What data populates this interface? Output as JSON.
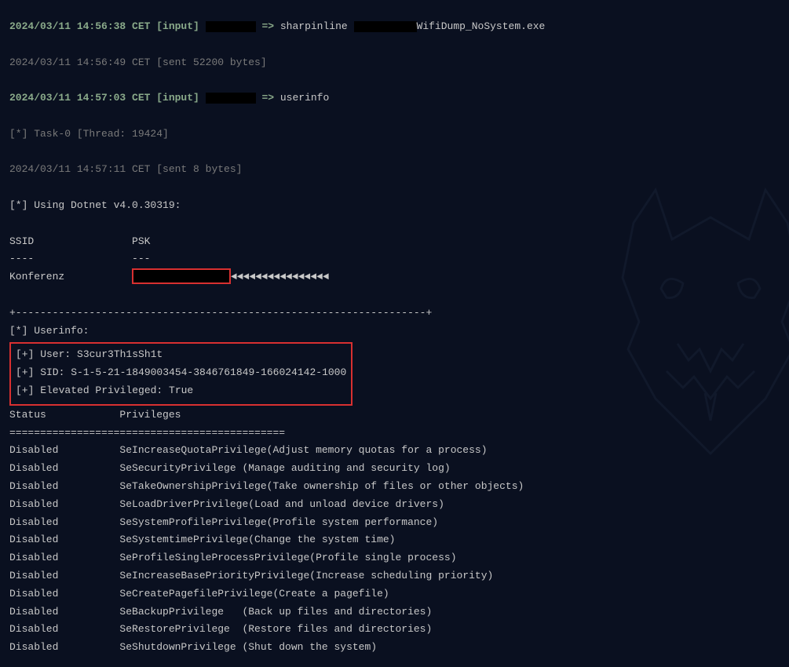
{
  "lines": {
    "l1_ts": "2024/03/11 14:56:38 CET [input]",
    "l1_arrow": " => ",
    "l1_cmd": "sharpinline",
    "l1_exe": "WifiDump_NoSystem.exe",
    "l2": "2024/03/11 14:56:49 CET [sent 52200 bytes]",
    "l3_ts": "2024/03/11 14:57:03 CET [input]",
    "l3_arrow": " => ",
    "l3_cmd": "userinfo",
    "l4": "[*] Task-0 [Thread: 19424]",
    "l5": "2024/03/11 14:57:11 CET [sent 8 bytes]",
    "l6": "[*] Using Dotnet v4.0.30319:",
    "hdr_ssid": "SSID",
    "hdr_psk": "PSK",
    "sep_ssid": "----",
    "sep_psk": "---",
    "ssid_name": "Konferenz",
    "triangles": "◄◄◄◄◄◄◄◄◄◄◄◄◄◄◄◄",
    "divider": "+-------------------------------------------------------------------+",
    "userinfo_hdr": "[*] Userinfo:",
    "user_line": "[+] User: S3cur3Th1sSh1t",
    "sid_line": "[+] SID: S-1-5-21-1849003454-3846761849-166024142-1000",
    "elev_line": "[+] Elevated Privileged: True",
    "status_hdr": "Status            Privileges",
    "equals": "=============================================",
    "privs": [
      "Disabled          SeIncreaseQuotaPrivilege(Adjust memory quotas for a process)",
      "Disabled          SeSecurityPrivilege (Manage auditing and security log)",
      "Disabled          SeTakeOwnershipPrivilege(Take ownership of files or other objects)",
      "Disabled          SeLoadDriverPrivilege(Load and unload device drivers)",
      "Disabled          SeSystemProfilePrivilege(Profile system performance)",
      "Disabled          SeSystemtimePrivilege(Change the system time)",
      "Disabled          SeProfileSingleProcessPrivilege(Profile single process)",
      "Disabled          SeIncreaseBasePriorityPrivilege(Increase scheduling priority)",
      "Disabled          SeCreatePagefilePrivilege(Create a pagefile)",
      "Disabled          SeBackupPrivilege   (Back up files and directories)",
      "Disabled          SeRestorePrivilege  (Restore files and directories)",
      "Disabled          SeShutdownPrivilege (Shut down the system)"
    ]
  }
}
